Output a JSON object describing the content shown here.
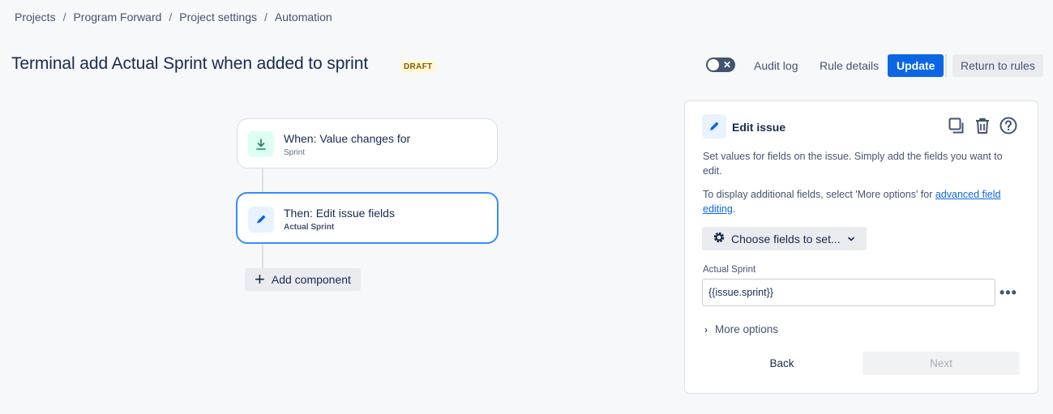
{
  "breadcrumb": [
    "Projects",
    "Program Forward",
    "Project settings",
    "Automation"
  ],
  "header": {
    "title": "Terminal add Actual Sprint when added to sprint",
    "status_badge": "DRAFT",
    "toggle_symbol": "✕",
    "audit_log": "Audit log",
    "rule_details": "Rule details",
    "update": "Update",
    "return_to_rules": "Return to rules"
  },
  "flow": {
    "trigger": {
      "title": "When: Value changes for",
      "subtitle": "Sprint",
      "icon": "trigger-arrow-down-icon",
      "icon_color": "#1f845a",
      "icon_bg": "#dcfff1"
    },
    "action": {
      "title": "Then: Edit issue fields",
      "subtitle": "Actual Sprint",
      "icon": "pencil-icon",
      "icon_color": "#0c66e4",
      "icon_bg": "#e9f2ff"
    },
    "add_component": "Add component"
  },
  "panel": {
    "title": "Edit issue",
    "description": "Set values for fields on the issue. Simply add the fields you want to edit.",
    "additional_prefix": "To display additional fields, select 'More options' for ",
    "additional_link": "advanced field editing",
    "additional_suffix": ".",
    "choose_fields": "Choose fields to set...",
    "field_label": "Actual Sprint",
    "field_value": "{{issue.sprint}}",
    "more_options": "More options",
    "back": "Back",
    "next": "Next"
  },
  "colors": {
    "accent": "#0c66e4",
    "selected_border": "#388bff",
    "draft_bg": "#fff7d6",
    "draft_text": "#7f5f01"
  }
}
